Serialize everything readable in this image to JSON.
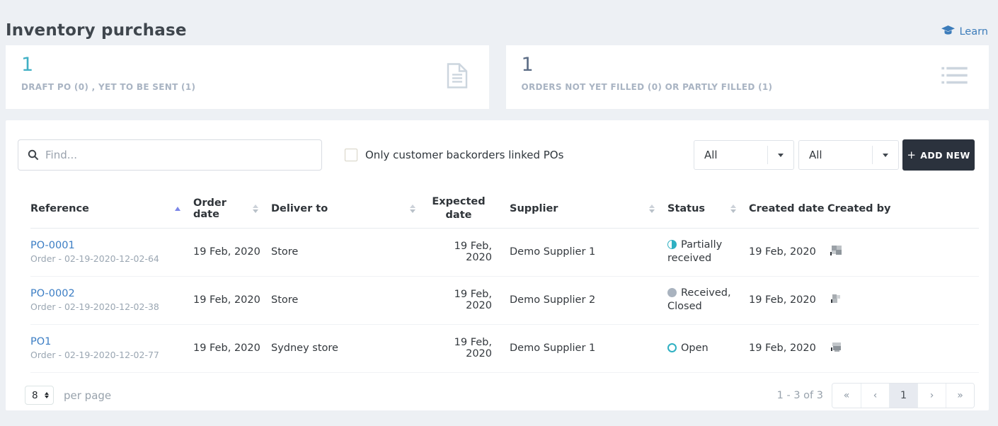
{
  "page": {
    "title": "Inventory purchase",
    "learn_label": "Learn"
  },
  "summary_cards": [
    {
      "count": "1",
      "label": "DRAFT PO (0) , YET TO BE SENT (1)",
      "icon": "document-icon",
      "count_color": "#41b0c5"
    },
    {
      "count": "1",
      "label": "ORDERS NOT YET FILLED (0) OR PARTLY FILLED (1)",
      "icon": "list-icon",
      "count_color": "#5b6c85"
    }
  ],
  "toolbar": {
    "search_placeholder": "Find...",
    "checkbox_label": "Only customer backorders linked POs",
    "checkbox_checked": false,
    "filters": [
      {
        "value": "All"
      },
      {
        "value": "All"
      }
    ],
    "add_new": {
      "plus": "+",
      "label": "ADD NEW"
    }
  },
  "table": {
    "columns": [
      "Reference",
      "Order date",
      "Deliver to",
      "Expected date",
      "Supplier",
      "Status",
      "Created date",
      "Created by"
    ],
    "sort": {
      "column": "Reference",
      "direction": "asc"
    },
    "rows": [
      {
        "reference": "PO-0001",
        "reference_sub": "Order - 02-19-2020-12-02-64",
        "order_date": "19 Feb, 2020",
        "deliver_to": "Store",
        "expected_date": "19 Feb, 2020",
        "supplier": "Demo Supplier 1",
        "status": "Partially received",
        "status_type": "partial",
        "created_date": "19 Feb, 2020"
      },
      {
        "reference": "PO-0002",
        "reference_sub": "Order - 02-19-2020-12-02-38",
        "order_date": "19 Feb, 2020",
        "deliver_to": "Store",
        "expected_date": "19 Feb, 2020",
        "supplier": "Demo Supplier 2",
        "status": "Received, Closed",
        "status_type": "closed",
        "created_date": "19 Feb, 2020"
      },
      {
        "reference": "PO1",
        "reference_sub": "Order - 02-19-2020-12-02-77",
        "order_date": "19 Feb, 2020",
        "deliver_to": "Sydney store",
        "expected_date": "19 Feb, 2020",
        "supplier": "Demo Supplier 1",
        "status": "Open",
        "status_type": "open",
        "created_date": "19 Feb, 2020"
      }
    ]
  },
  "footer": {
    "per_page_value": "8",
    "per_page_label": "per page",
    "range_label": "1 - 3 of 3",
    "pagination": [
      "«",
      "‹",
      "1",
      "›",
      "»"
    ],
    "current_page": "1"
  },
  "colors": {
    "accent_teal": "#2fb0c2",
    "link_blue": "#3b7dc4",
    "learn_blue": "#3c7cba",
    "button_dark": "#2b323d",
    "status_closed_gray": "#a9b3bf",
    "sort_active_purple": "#7b86e8",
    "page_background": "#edf0f4"
  }
}
